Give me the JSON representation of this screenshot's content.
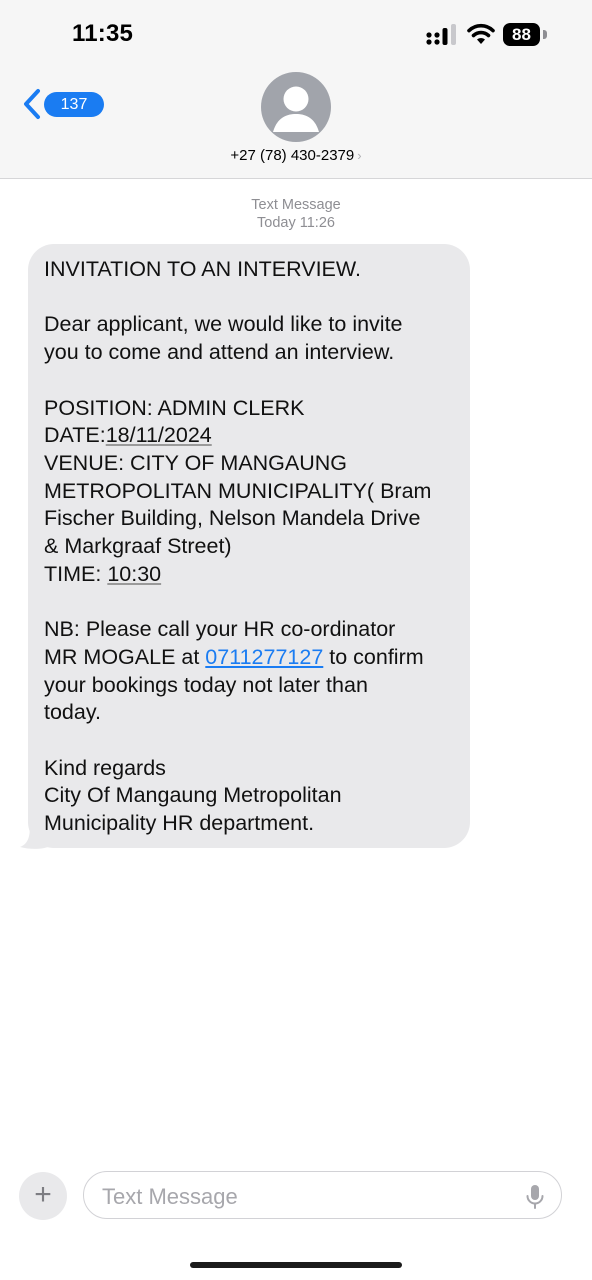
{
  "status_bar": {
    "time": "11:35",
    "battery": "88",
    "icons": [
      "signal-icon",
      "wifi-icon",
      "battery-icon"
    ]
  },
  "header": {
    "back_badge": "137",
    "contact": "+27 (78) 430-2379",
    "contact_chevron": "›",
    "avatar_icon": "person-icon"
  },
  "conversation": {
    "service": "Text Message",
    "timestamp": "Today 11:26"
  },
  "message": {
    "line1": "INVITATION TO AN INTERVIEW.",
    "para2": "Dear applicant, we would like to invite\nyou to come and attend an interview.",
    "position": "POSITION: ADMIN CLERK",
    "date_label": "DATE:",
    "date_value": "18/11/2024",
    "venue": "VENUE: CITY OF MANGAUNG\nMETROPOLITAN MUNICIPALITY( Bram\nFischer Building, Nelson Mandela Drive\n& Markgraaf Street)",
    "time_label": "TIME: ",
    "time_value": "10:30",
    "nb_before": "NB: Please call your HR co-ordinator\nMR MOGALE at ",
    "phone_link": "0711277127",
    "nb_after": " to confirm\nyour bookings today not later than\ntoday.",
    "closing": "Kind regards\nCity Of Mangaung Metropolitan\nMunicipality HR department."
  },
  "composer": {
    "placeholder": "Text Message",
    "plus": "+",
    "mic_icon": "microphone-icon"
  },
  "colors": {
    "accent": "#1a7cf2",
    "bubble": "#e9e9eb",
    "header_bg": "#f6f6f6"
  }
}
